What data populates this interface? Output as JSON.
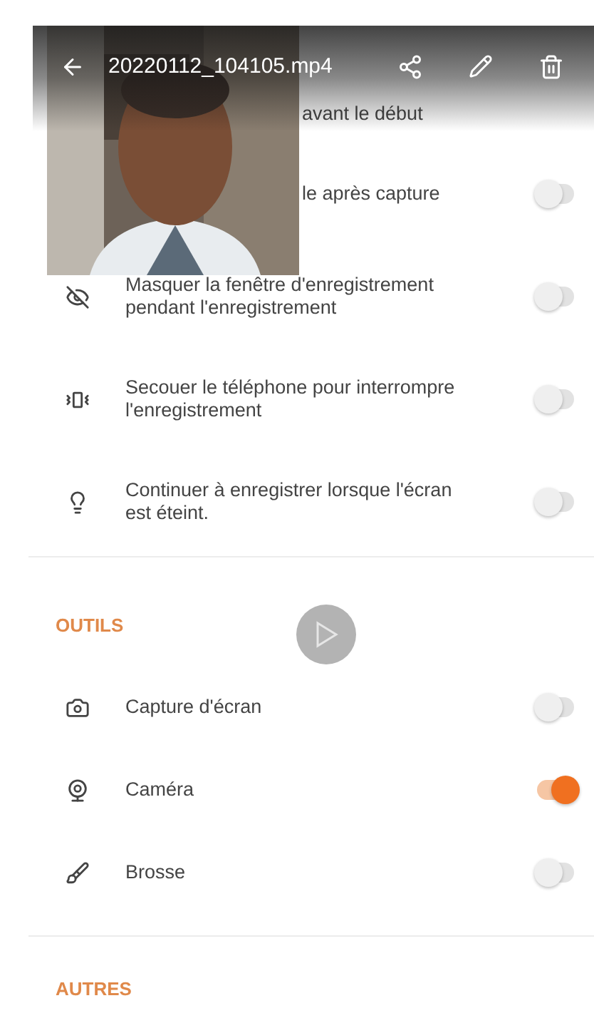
{
  "top_bar": {
    "title": "20220112_104105.mp4"
  },
  "sections": [
    {
      "rows": [
        {
          "label": "avant le début"
        },
        {
          "label": "le après capture",
          "on": false
        },
        {
          "label": "Masquer la fenêtre d'enregistrement pendant l'enregistrement",
          "on": false
        },
        {
          "label": "Secouer le téléphone pour interrompre l'enregistrement",
          "on": false
        },
        {
          "label": "Continuer à enregistrer lorsque l'écran est éteint.",
          "on": false
        }
      ]
    },
    {
      "heading": "OUTILS",
      "rows": [
        {
          "label": "Capture d'écran",
          "on": false
        },
        {
          "label": "Caméra",
          "on": true
        },
        {
          "label": "Brosse",
          "on": false
        }
      ]
    },
    {
      "heading": "AUTRES"
    }
  ]
}
